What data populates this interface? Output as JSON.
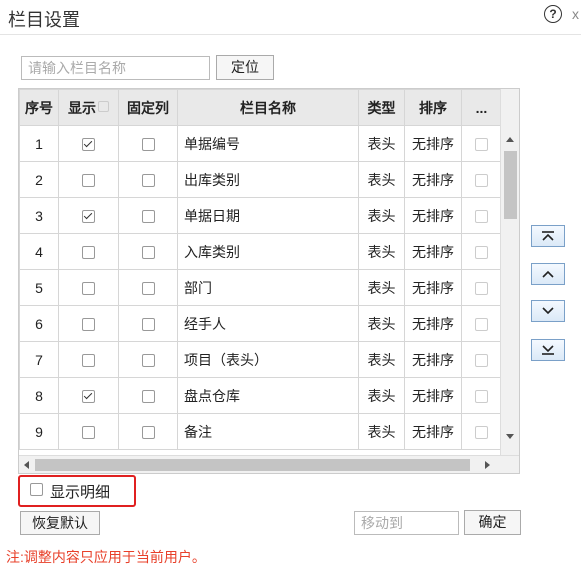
{
  "dialog": {
    "title": "栏目设置",
    "help_icon": "?",
    "close_icon": "x"
  },
  "search": {
    "placeholder": "请输入栏目名称",
    "value": "",
    "locate_label": "定位"
  },
  "table": {
    "headers": {
      "seq": "序号",
      "show": "显示",
      "fixed": "固定列",
      "name": "栏目名称",
      "type": "类型",
      "sort": "排序",
      "more": "..."
    },
    "rows": [
      {
        "seq": "1",
        "show": true,
        "fixed": false,
        "name": "单据编号",
        "type": "表头",
        "sort": "无排序"
      },
      {
        "seq": "2",
        "show": false,
        "fixed": false,
        "name": "出库类别",
        "type": "表头",
        "sort": "无排序"
      },
      {
        "seq": "3",
        "show": true,
        "fixed": false,
        "name": "单据日期",
        "type": "表头",
        "sort": "无排序"
      },
      {
        "seq": "4",
        "show": false,
        "fixed": false,
        "name": "入库类别",
        "type": "表头",
        "sort": "无排序"
      },
      {
        "seq": "5",
        "show": false,
        "fixed": false,
        "name": "部门",
        "type": "表头",
        "sort": "无排序"
      },
      {
        "seq": "6",
        "show": false,
        "fixed": false,
        "name": "经手人",
        "type": "表头",
        "sort": "无排序"
      },
      {
        "seq": "7",
        "show": false,
        "fixed": false,
        "name": "项目（表头）",
        "type": "表头",
        "sort": "无排序"
      },
      {
        "seq": "8",
        "show": true,
        "fixed": false,
        "name": "盘点仓库",
        "type": "表头",
        "sort": "无排序"
      },
      {
        "seq": "9",
        "show": false,
        "fixed": false,
        "name": "备注",
        "type": "表头",
        "sort": "无排序"
      }
    ]
  },
  "move_buttons": [
    "move-to-top",
    "move-up",
    "move-down",
    "move-to-bottom"
  ],
  "show_detail": {
    "label": "显示明细",
    "checked": false
  },
  "footer": {
    "reset_label": "恢复默认",
    "moveto_placeholder": "移动到",
    "ok_label": "确定"
  },
  "note": "注:调整内容只应用于当前用户。"
}
